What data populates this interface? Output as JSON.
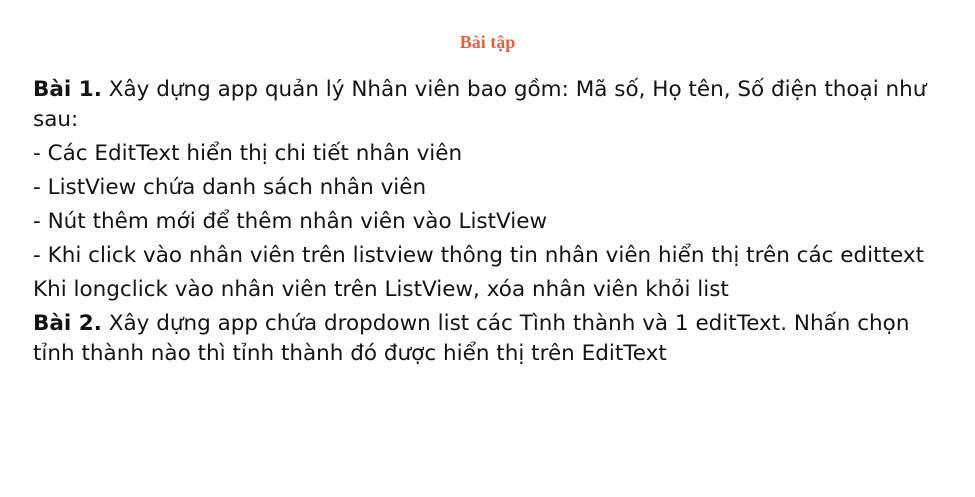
{
  "document": {
    "title": "Bài tập",
    "exercises": [
      {
        "label": "Bài 1.",
        "text": "Xây dựng app quản lý Nhân viên bao gồm: Mã số, Họ tên, Số điện thoại như sau:"
      },
      {
        "label": "Bài 2.",
        "text": "Xây dựng app chứa dropdown list các Tình thành và 1 editText. Nhấn chọn tỉnh thành nào thì tỉnh thành đó được hiển thị trên EditText"
      }
    ],
    "bullets": [
      "- Các EditText hiển thị chi tiết nhân viên",
      "- ListView chứa danh sách nhân viên",
      "- Nút thêm mới để thêm nhân viên vào ListView",
      "- Khi click vào nhân viên trên listview thông tin nhân viên hiển thị trên các edittext",
      "Khi longclick vào nhân viên trên ListView, xóa nhân viên khỏi list"
    ],
    "colors": {
      "title": "#e8603c",
      "text": "#141414",
      "background": "#ffffff"
    }
  }
}
